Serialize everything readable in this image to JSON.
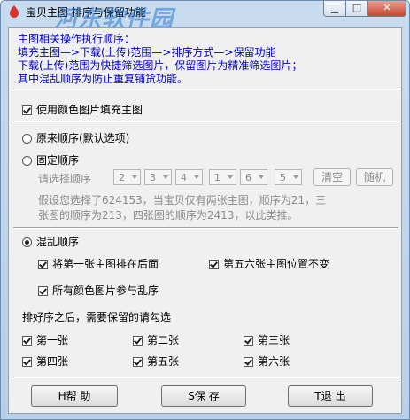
{
  "window": {
    "title": "宝贝主图 排序与保留功能",
    "watermark": "河东软件园",
    "min_glyph": "▁",
    "max_glyph": "□",
    "close_glyph": "✕"
  },
  "info": {
    "line1": "主图相关操作执行顺序：",
    "line2": "填充主图—>下载(上传)范围—>排序方式—>保留功能",
    "line3": "下载(上传)范围为快捷筛选图片，保留图片为精准筛选图片；",
    "line4": "其中混乱顺序为防止重复铺货功能。"
  },
  "options": {
    "fill_main": {
      "label": "使用颜色图片填充主图",
      "checked": true
    },
    "original_order": {
      "label": "原来顺序(默认选项)",
      "checked": false
    },
    "fixed_order": {
      "label": "固定顺序",
      "checked": false
    },
    "choose_order_label": "请选择顺序",
    "order_values": [
      "2",
      "3",
      "4",
      "1",
      "6",
      "5"
    ],
    "clear_label": "清空",
    "random_label": "随机",
    "example_line1": "假设您选择了624153，当宝贝仅有两张主图，顺序为21，三",
    "example_line2": "张图的顺序为213，四张图的顺序为2413，以此类推。",
    "shuffle_order": {
      "label": "混乱顺序",
      "checked": true
    },
    "first_last": {
      "label": "将第一张主图排在后面",
      "checked": true
    },
    "fifth_sixth_fixed": {
      "label": "第五六张主图位置不变",
      "checked": true
    },
    "all_color_shuffle": {
      "label": "所有颜色图片参与乱序",
      "checked": true
    }
  },
  "retain": {
    "heading": "排好序之后，需要保留的请勾选",
    "items": [
      {
        "label": "第一张",
        "checked": true
      },
      {
        "label": "第二张",
        "checked": true
      },
      {
        "label": "第三张",
        "checked": true
      },
      {
        "label": "第四张",
        "checked": true
      },
      {
        "label": "第五张",
        "checked": true
      },
      {
        "label": "第六张",
        "checked": true
      }
    ]
  },
  "buttons": {
    "help_label": "H帮 助",
    "save_label": "S保 存",
    "exit_label": "T退 出"
  }
}
